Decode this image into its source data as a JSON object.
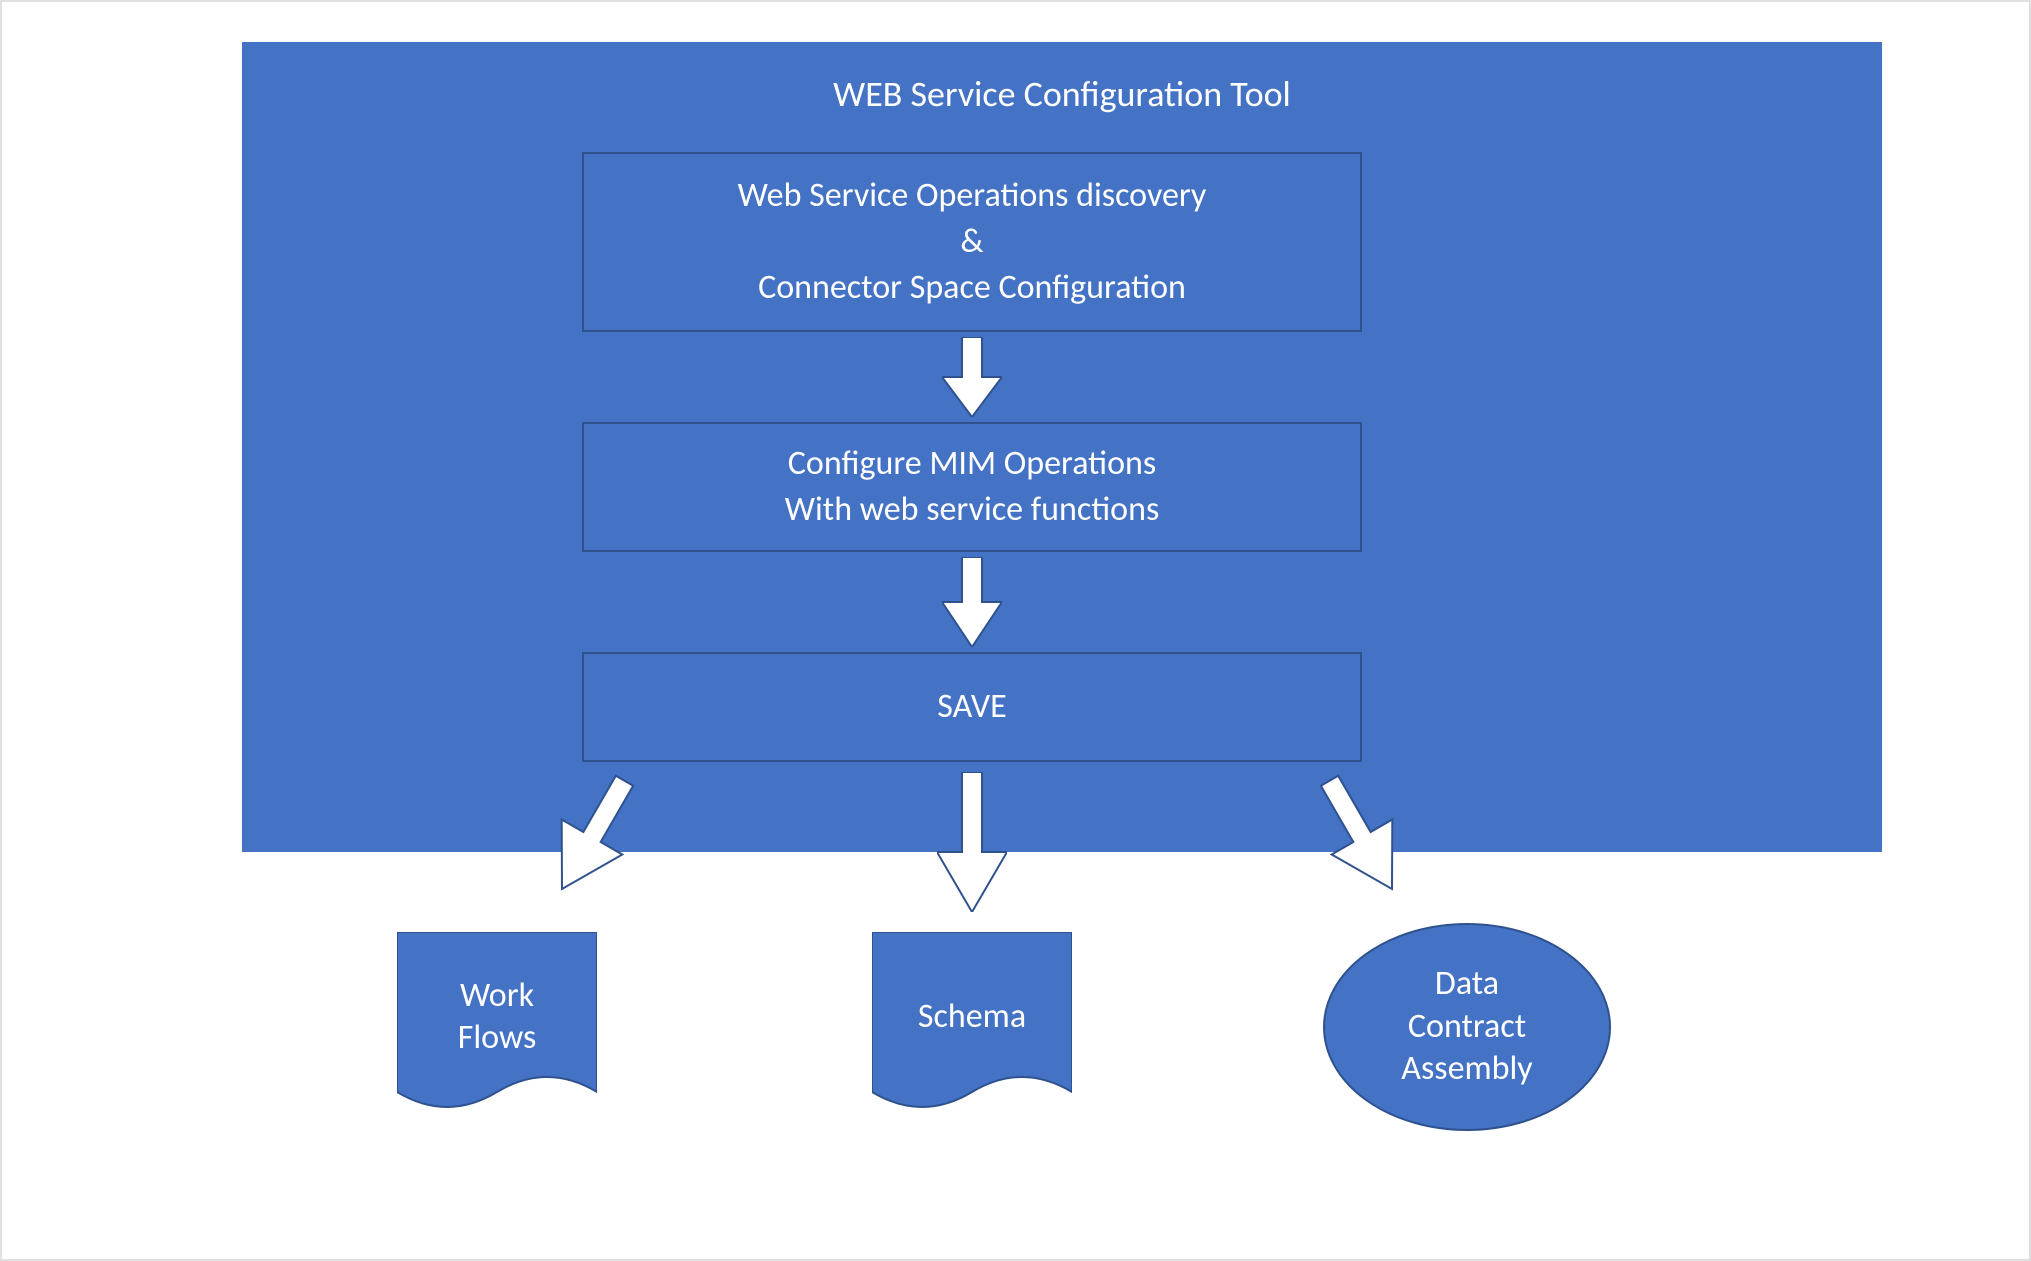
{
  "colors": {
    "primary": "#4472C4",
    "boxBorder": "#2F528F",
    "arrowFill": "#FFFFFF",
    "arrowStroke": "#2F528F",
    "outputFill": "#4472C4",
    "outputStroke": "#2F528F"
  },
  "main": {
    "title": "WEB Service Configuration Tool",
    "steps": {
      "discovery": {
        "line1": "Web Service Operations discovery",
        "line2": "&",
        "line3": "Connector Space Configuration"
      },
      "configure": {
        "line1": "Configure MIM Operations",
        "line2": "With web service functions"
      },
      "save": {
        "line1": "SAVE"
      }
    }
  },
  "outputs": {
    "workflows": {
      "line1": "Work",
      "line2": "Flows"
    },
    "schema": {
      "line1": "Schema"
    },
    "assembly": {
      "line1": "Data",
      "line2": "Contract",
      "line3": "Assembly"
    }
  }
}
